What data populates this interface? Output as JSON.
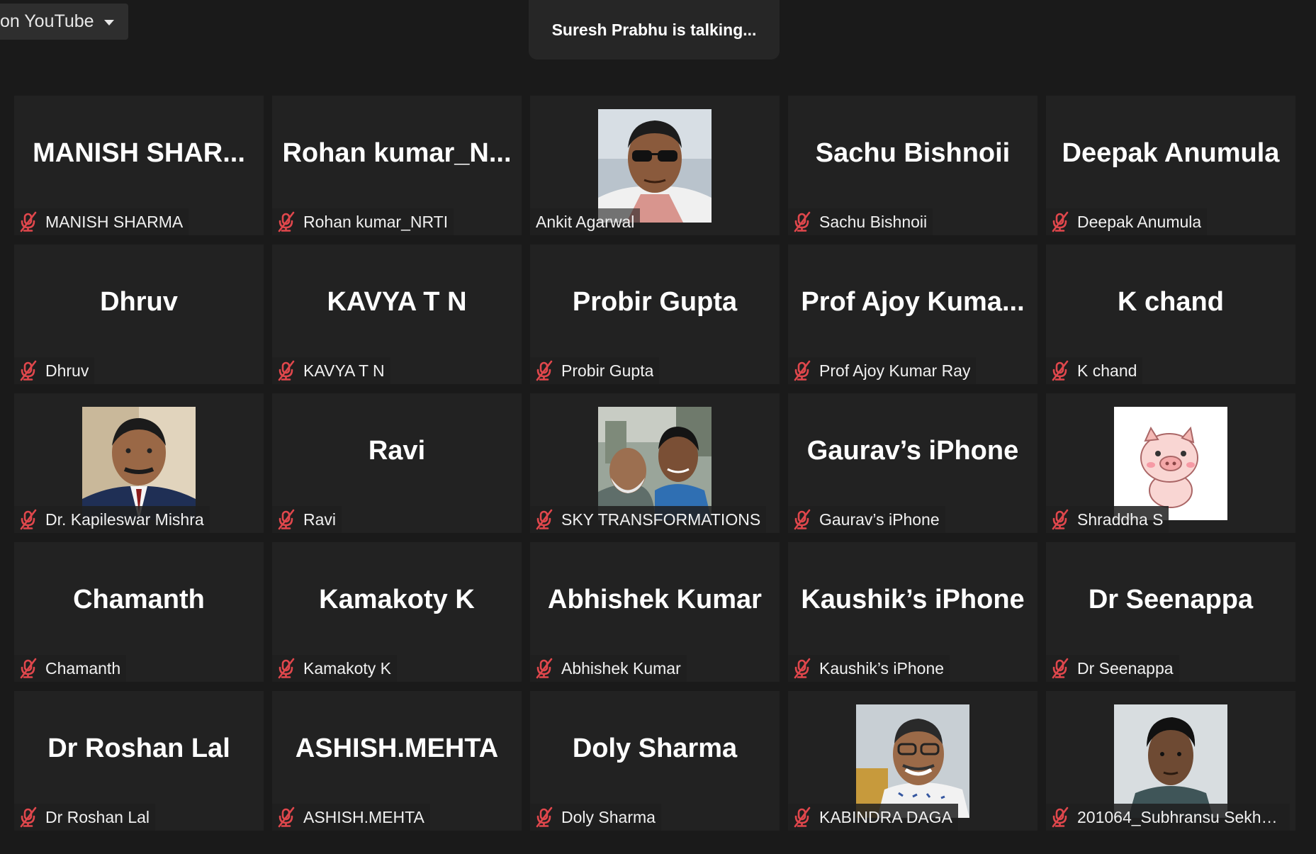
{
  "live_stream": {
    "label": "on YouTube"
  },
  "speaker_bar": {
    "text": "Suresh Prabhu is talking..."
  },
  "participants": [
    {
      "display_name": "MANISH  SHAR...",
      "name_tag": "MANISH SHARMA",
      "muted": true,
      "has_photo": false
    },
    {
      "display_name": "Rohan  kumar_N...",
      "name_tag": "Rohan kumar_NRTI",
      "muted": true,
      "has_photo": false
    },
    {
      "display_name": "",
      "name_tag": "Ankit Agarwal",
      "muted": false,
      "has_photo": true,
      "photo": "man-sunglasses-photo"
    },
    {
      "display_name": "Sachu Bishnoii",
      "name_tag": "Sachu Bishnoii",
      "muted": true,
      "has_photo": false
    },
    {
      "display_name": "Deepak Anumula",
      "name_tag": "Deepak Anumula",
      "muted": true,
      "has_photo": false
    },
    {
      "display_name": "Dhruv",
      "name_tag": "Dhruv",
      "muted": true,
      "has_photo": false
    },
    {
      "display_name": "KAVYA T N",
      "name_tag": "KAVYA T N",
      "muted": true,
      "has_photo": false
    },
    {
      "display_name": "Probir Gupta",
      "name_tag": "Probir Gupta",
      "muted": true,
      "has_photo": false
    },
    {
      "display_name": "Prof  Ajoy  Kuma...",
      "name_tag": "Prof Ajoy Kumar Ray",
      "muted": true,
      "has_photo": false
    },
    {
      "display_name": "K chand",
      "name_tag": "K chand",
      "muted": true,
      "has_photo": false
    },
    {
      "display_name": "",
      "name_tag": "Dr. Kapileswar Mishra",
      "muted": true,
      "has_photo": true,
      "photo": "man-suit-portrait-photo"
    },
    {
      "display_name": "Ravi",
      "name_tag": "Ravi",
      "muted": true,
      "has_photo": false
    },
    {
      "display_name": "",
      "name_tag": "SKY TRANSFORMATIONS",
      "muted": true,
      "has_photo": true,
      "photo": "two-men-outdoor-photo"
    },
    {
      "display_name": "Gaurav’s iPhone",
      "name_tag": "Gaurav’s iPhone",
      "muted": true,
      "has_photo": false
    },
    {
      "display_name": "",
      "name_tag": "Shraddha S",
      "muted": true,
      "has_photo": true,
      "photo": "pig-cartoon-avatar"
    },
    {
      "display_name": "Chamanth",
      "name_tag": "Chamanth",
      "muted": true,
      "has_photo": false
    },
    {
      "display_name": "Kamakoty K",
      "name_tag": "Kamakoty K",
      "muted": true,
      "has_photo": false
    },
    {
      "display_name": "Abhishek Kumar",
      "name_tag": "Abhishek Kumar",
      "muted": true,
      "has_photo": false
    },
    {
      "display_name": "Kaushik’s iPhone",
      "name_tag": "Kaushik’s iPhone",
      "muted": true,
      "has_photo": false
    },
    {
      "display_name": "Dr Seenappa",
      "name_tag": "Dr Seenappa",
      "muted": true,
      "has_photo": false
    },
    {
      "display_name": "Dr Roshan Lal",
      "name_tag": "Dr Roshan Lal",
      "muted": true,
      "has_photo": false
    },
    {
      "display_name": "ASHISH.MEHTA",
      "name_tag": "ASHISH.MEHTA",
      "muted": true,
      "has_photo": false
    },
    {
      "display_name": "Doly Sharma",
      "name_tag": "Doly Sharma",
      "muted": true,
      "has_photo": false
    },
    {
      "display_name": "",
      "name_tag": "KABINDRA DAGA",
      "muted": true,
      "has_photo": true,
      "photo": "man-glasses-smiling-photo"
    },
    {
      "display_name": "",
      "name_tag": "201064_Subhransu Sekhar ...",
      "muted": true,
      "has_photo": true,
      "photo": "young-man-portrait-photo"
    }
  ],
  "colors": {
    "background": "#1a1a1a",
    "tile": "#222222",
    "mute_icon": "#e0474c",
    "text": "#ffffff"
  }
}
